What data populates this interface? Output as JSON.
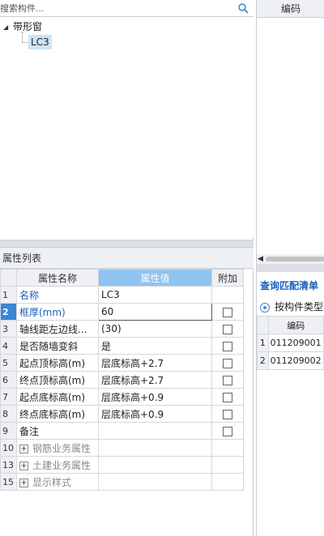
{
  "search": {
    "placeholder": "搜索构件..."
  },
  "tree": {
    "root": "带形窗",
    "child": "LC3"
  },
  "property_list": {
    "title": "属性列表",
    "headers": [
      "属性名称",
      "属性值",
      "附加"
    ],
    "rows": [
      {
        "num": "1",
        "name": "名称",
        "value": "LC3",
        "checkbox": false
      },
      {
        "num": "2",
        "name": "框厚(mm)",
        "value": "60",
        "checkbox": true
      },
      {
        "num": "3",
        "name": "轴线距左边线...",
        "value": "(30)",
        "checkbox": true
      },
      {
        "num": "4",
        "name": "是否随墙变斜",
        "value": "是",
        "checkbox": true
      },
      {
        "num": "5",
        "name": "起点顶标高(m)",
        "value": "层底标高+2.7",
        "checkbox": true
      },
      {
        "num": "6",
        "name": "终点顶标高(m)",
        "value": "层底标高+2.7",
        "checkbox": true
      },
      {
        "num": "7",
        "name": "起点底标高(m)",
        "value": "层底标高+0.9",
        "checkbox": true
      },
      {
        "num": "8",
        "name": "终点底标高(m)",
        "value": "层底标高+0.9",
        "checkbox": true
      },
      {
        "num": "9",
        "name": "备注",
        "value": "",
        "checkbox": true
      },
      {
        "num": "10",
        "name": "钢筋业务属性",
        "value": "",
        "checkbox": false
      },
      {
        "num": "13",
        "name": "土建业务属性",
        "value": "",
        "checkbox": false
      },
      {
        "num": "15",
        "name": "显示样式",
        "value": "",
        "checkbox": false
      }
    ]
  },
  "right_panel": {
    "header": "编码",
    "query_title": "查询匹配清单",
    "radio_label": "按构件类型",
    "table_header": "编码",
    "rows": [
      {
        "num": "1",
        "code": "011209001"
      },
      {
        "num": "2",
        "code": "011209002"
      }
    ]
  },
  "colors": {
    "accent": "#3c86d6",
    "header_blue": "#8fc3f2",
    "link_blue": "#1a5fb8"
  }
}
